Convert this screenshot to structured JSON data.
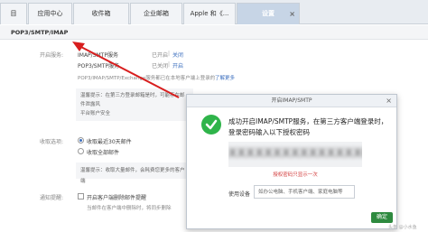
{
  "tabs": [
    {
      "label": "目"
    },
    {
      "label": "应用中心"
    },
    {
      "label": "收件箱"
    },
    {
      "label": "企业邮箱"
    },
    {
      "label": "Apple 和《..."
    },
    {
      "label": "设置"
    }
  ],
  "tab_close": "×",
  "section_title": "POP3/SMTP/IMAP",
  "services": {
    "label": "开启服务:",
    "rows": [
      {
        "name": "IMAP/SMTP服务",
        "status": "已开启",
        "sep": "|",
        "action": "关闭"
      },
      {
        "name": "POP3/SMTP服务",
        "status": "已关闭",
        "sep": "|",
        "action": "开启"
      }
    ],
    "note": "POP3/IMAP/SMTP/Exchange服务都已在本地客户端上登录的",
    "learn_more": "了解更多"
  },
  "tip1": {
    "line1": "温馨提示：在第三方登录邮箱是时，可能存在邮件泄露风",
    "line2": "平台账户安全"
  },
  "receive": {
    "label": "收取选项:",
    "options": [
      {
        "text": "收取最近30天邮件"
      },
      {
        "text": "收取全部邮件"
      }
    ],
    "tip": "温馨提示：收取大量邮件，会耗费您更多的客户端"
  },
  "delete": {
    "label": "通知提醒:",
    "option": "开启客户端删除邮件提醒",
    "note": "当邮件在客户端中删除时，将同步删除"
  },
  "modal": {
    "title": "开启IMAP/SMTP",
    "close": "×",
    "message": "成功开启IMAP/SMTP服务，在第三方客户端登录时，登录密码输入以下授权密码",
    "code": "XXXXXXXXXXXXXXXK",
    "warning": "授权密码只显示一次",
    "device_label": "使用设备",
    "device_placeholder": "如办公电脑、手机客户端、家庭电脑等",
    "ok": "确定"
  },
  "watermark": "头条 @小水鱼"
}
